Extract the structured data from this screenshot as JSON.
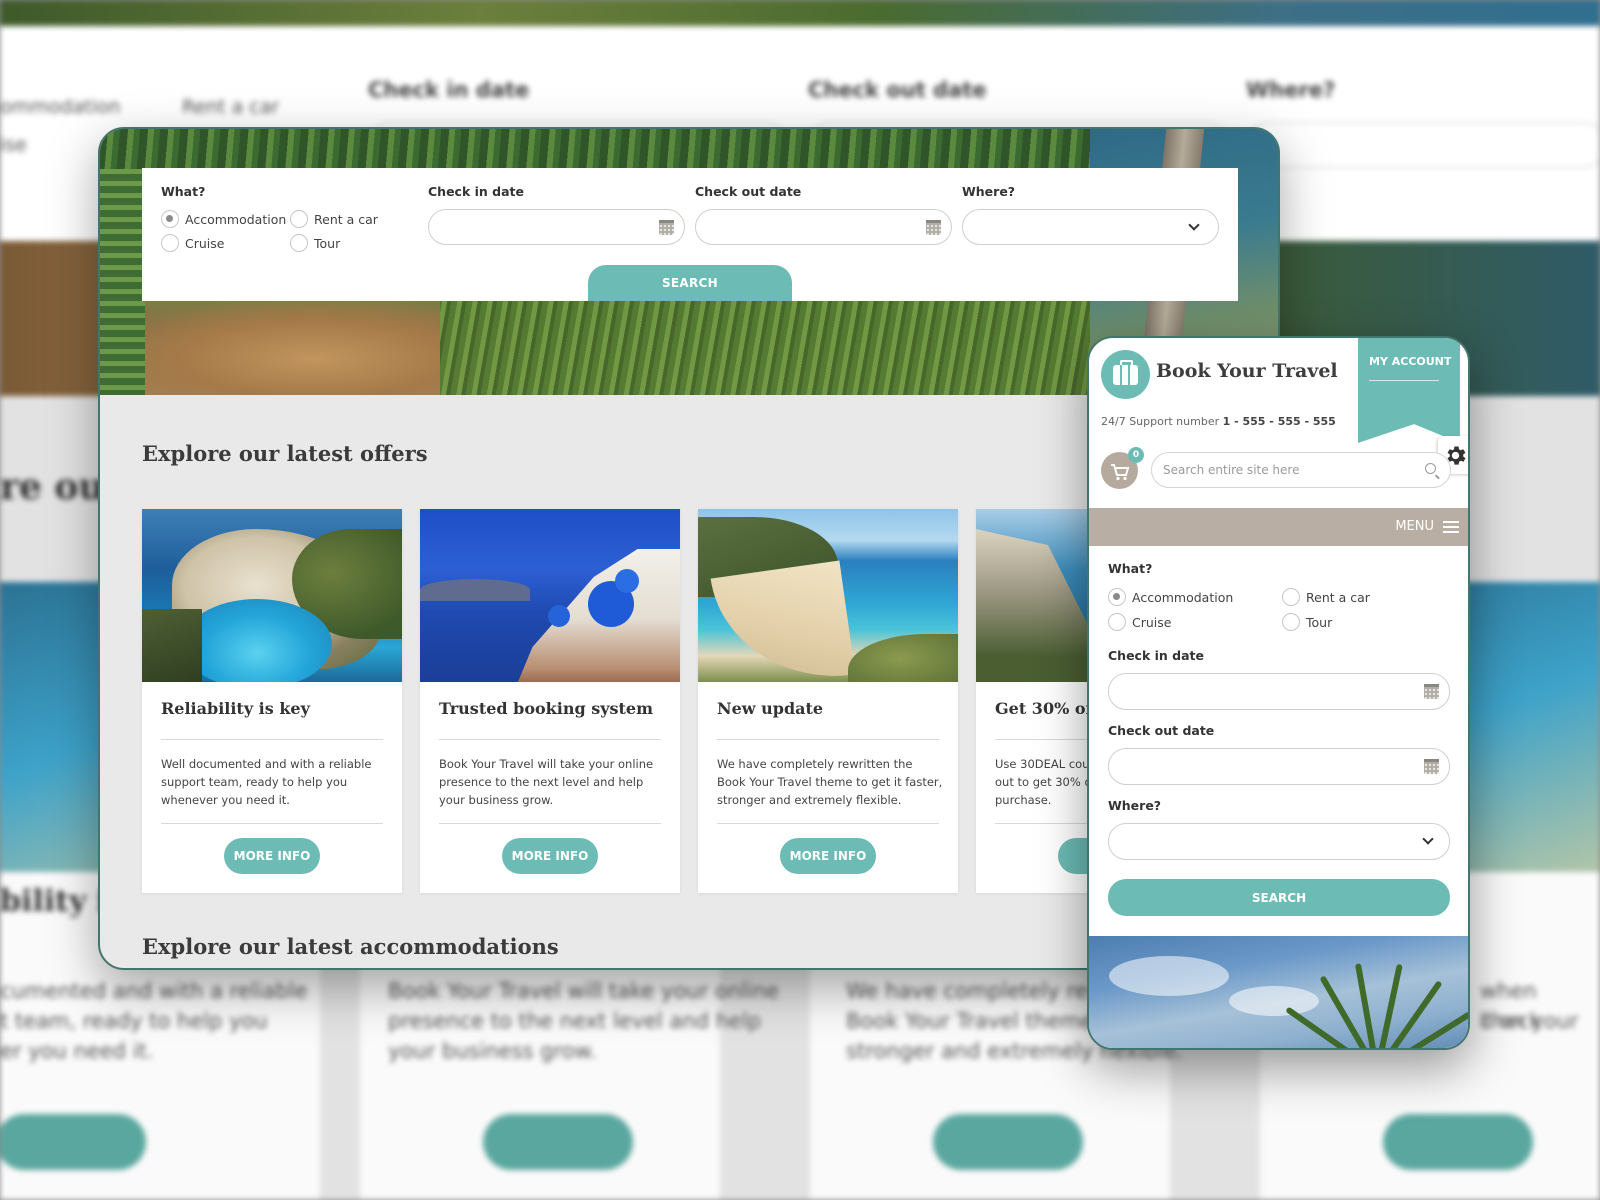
{
  "background": {
    "labels": [
      "Check in date",
      "Check out date",
      "Where?"
    ],
    "radio_labels": [
      "ommodation",
      "Rent a car",
      "ise"
    ],
    "heading": "re our",
    "card_heading": "bility is",
    "text_lines": [
      "cumented and with a reliable",
      "t team, ready to help you",
      "er you need it.",
      "Book Your Travel will take your online",
      "presence to the next level and help",
      "your business grow.",
      "We have completely rewritten the",
      "Book Your Travel theme to get it faster,",
      "stronger and extremely flexible.",
      "when check",
      "ll on your"
    ]
  },
  "desktop": {
    "search": {
      "what_label": "What?",
      "options": [
        {
          "label": "Accommodation",
          "selected": true
        },
        {
          "label": "Rent a car",
          "selected": false
        },
        {
          "label": "Cruise",
          "selected": false
        },
        {
          "label": "Tour",
          "selected": false
        }
      ],
      "checkin_label": "Check in date",
      "checkout_label": "Check out date",
      "where_label": "Where?",
      "button": "SEARCH"
    },
    "offers_title": "Explore our latest offers",
    "cards": [
      {
        "title": "Reliability is key",
        "text": "Well documented and with a reliable support team, ready to help you whenever you need it.",
        "button": "MORE INFO"
      },
      {
        "title": "Trusted booking system",
        "text": "Book Your Travel will take your online presence to the next level and help your business grow.",
        "button": "MORE INFO"
      },
      {
        "title": "New update",
        "text": "We have completely rewritten the Book Your Travel theme to get it faster, stronger and extremely flexible.",
        "button": "MORE INFO"
      },
      {
        "title": "Get 30% off",
        "text": "Use 30DEAL cou out to get 30% d purchase.",
        "button": "MO"
      }
    ],
    "accommodations_title": "Explore our latest accommodations"
  },
  "mobile": {
    "brand": "Book Your Travel",
    "account": "MY ACCOUNT",
    "support_prefix": "24/7 Support number",
    "support_number": "1 - 555 - 555 - 555",
    "cart_count": "0",
    "search_placeholder": "Search entire site here",
    "menu": "MENU",
    "what_label": "What?",
    "options": [
      {
        "label": "Accommodation",
        "selected": true
      },
      {
        "label": "Rent a car",
        "selected": false
      },
      {
        "label": "Cruise",
        "selected": false
      },
      {
        "label": "Tour",
        "selected": false
      }
    ],
    "checkin_label": "Check in date",
    "checkout_label": "Check out date",
    "where_label": "Where?",
    "button": "SEARCH"
  },
  "colors": {
    "accent": "#6cbcb5",
    "frame": "#41766e",
    "menubar": "#b8aea4"
  }
}
